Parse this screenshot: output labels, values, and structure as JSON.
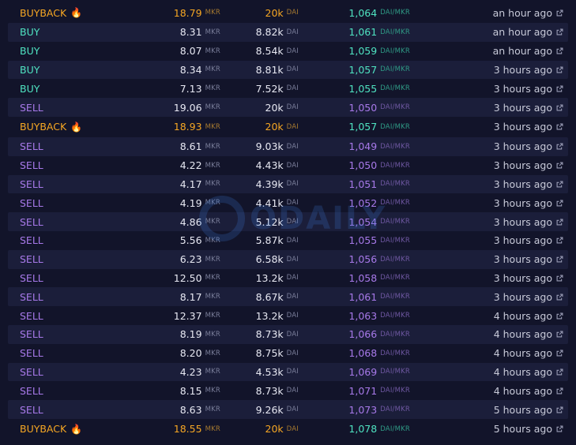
{
  "colors": {
    "background": "#12142a",
    "row_alt": "#1b1e3a",
    "buyback": "#f5a623",
    "buy": "#4fe3c1",
    "sell": "#a779e9"
  },
  "watermark": {
    "text": "ODAILY"
  },
  "trades": [
    {
      "type": "BUYBACK",
      "fire": "🔥",
      "amount": "18.79",
      "amount_unit": "MKR",
      "dai": "20k",
      "dai_unit": "DAI",
      "price": "1,064",
      "price_unit": "DAI/MKR",
      "price_color": "teal",
      "time": "an hour ago"
    },
    {
      "type": "BUY",
      "amount": "8.31",
      "amount_unit": "MKR",
      "dai": "8.82k",
      "dai_unit": "DAI",
      "price": "1,061",
      "price_unit": "DAI/MKR",
      "price_color": "teal",
      "time": "an hour ago"
    },
    {
      "type": "BUY",
      "amount": "8.07",
      "amount_unit": "MKR",
      "dai": "8.54k",
      "dai_unit": "DAI",
      "price": "1,059",
      "price_unit": "DAI/MKR",
      "price_color": "teal",
      "time": "an hour ago"
    },
    {
      "type": "BUY",
      "amount": "8.34",
      "amount_unit": "MKR",
      "dai": "8.81k",
      "dai_unit": "DAI",
      "price": "1,057",
      "price_unit": "DAI/MKR",
      "price_color": "teal",
      "time": "3 hours ago"
    },
    {
      "type": "BUY",
      "amount": "7.13",
      "amount_unit": "MKR",
      "dai": "7.52k",
      "dai_unit": "DAI",
      "price": "1,055",
      "price_unit": "DAI/MKR",
      "price_color": "teal",
      "time": "3 hours ago"
    },
    {
      "type": "SELL",
      "amount": "19.06",
      "amount_unit": "MKR",
      "dai": "20k",
      "dai_unit": "DAI",
      "price": "1,050",
      "price_unit": "DAI/MKR",
      "price_color": "purple",
      "time": "3 hours ago"
    },
    {
      "type": "BUYBACK",
      "fire": "🔥",
      "amount": "18.93",
      "amount_unit": "MKR",
      "dai": "20k",
      "dai_unit": "DAI",
      "price": "1,057",
      "price_unit": "DAI/MKR",
      "price_color": "teal",
      "time": "3 hours ago"
    },
    {
      "type": "SELL",
      "amount": "8.61",
      "amount_unit": "MKR",
      "dai": "9.03k",
      "dai_unit": "DAI",
      "price": "1,049",
      "price_unit": "DAI/MKR",
      "price_color": "purple",
      "time": "3 hours ago"
    },
    {
      "type": "SELL",
      "amount": "4.22",
      "amount_unit": "MKR",
      "dai": "4.43k",
      "dai_unit": "DAI",
      "price": "1,050",
      "price_unit": "DAI/MKR",
      "price_color": "purple",
      "time": "3 hours ago"
    },
    {
      "type": "SELL",
      "amount": "4.17",
      "amount_unit": "MKR",
      "dai": "4.39k",
      "dai_unit": "DAI",
      "price": "1,051",
      "price_unit": "DAI/MKR",
      "price_color": "purple",
      "time": "3 hours ago"
    },
    {
      "type": "SELL",
      "amount": "4.19",
      "amount_unit": "MKR",
      "dai": "4.41k",
      "dai_unit": "DAI",
      "price": "1,052",
      "price_unit": "DAI/MKR",
      "price_color": "purple",
      "time": "3 hours ago"
    },
    {
      "type": "SELL",
      "amount": "4.86",
      "amount_unit": "MKR",
      "dai": "5.12k",
      "dai_unit": "DAI",
      "price": "1,054",
      "price_unit": "DAI/MKR",
      "price_color": "purple",
      "time": "3 hours ago"
    },
    {
      "type": "SELL",
      "amount": "5.56",
      "amount_unit": "MKR",
      "dai": "5.87k",
      "dai_unit": "DAI",
      "price": "1,055",
      "price_unit": "DAI/MKR",
      "price_color": "purple",
      "time": "3 hours ago"
    },
    {
      "type": "SELL",
      "amount": "6.23",
      "amount_unit": "MKR",
      "dai": "6.58k",
      "dai_unit": "DAI",
      "price": "1,056",
      "price_unit": "DAI/MKR",
      "price_color": "purple",
      "time": "3 hours ago"
    },
    {
      "type": "SELL",
      "amount": "12.50",
      "amount_unit": "MKR",
      "dai": "13.2k",
      "dai_unit": "DAI",
      "price": "1,058",
      "price_unit": "DAI/MKR",
      "price_color": "purple",
      "time": "3 hours ago"
    },
    {
      "type": "SELL",
      "amount": "8.17",
      "amount_unit": "MKR",
      "dai": "8.67k",
      "dai_unit": "DAI",
      "price": "1,061",
      "price_unit": "DAI/MKR",
      "price_color": "purple",
      "time": "3 hours ago"
    },
    {
      "type": "SELL",
      "amount": "12.37",
      "amount_unit": "MKR",
      "dai": "13.2k",
      "dai_unit": "DAI",
      "price": "1,063",
      "price_unit": "DAI/MKR",
      "price_color": "purple",
      "time": "4 hours ago"
    },
    {
      "type": "SELL",
      "amount": "8.19",
      "amount_unit": "MKR",
      "dai": "8.73k",
      "dai_unit": "DAI",
      "price": "1,066",
      "price_unit": "DAI/MKR",
      "price_color": "purple",
      "time": "4 hours ago"
    },
    {
      "type": "SELL",
      "amount": "8.20",
      "amount_unit": "MKR",
      "dai": "8.75k",
      "dai_unit": "DAI",
      "price": "1,068",
      "price_unit": "DAI/MKR",
      "price_color": "purple",
      "time": "4 hours ago"
    },
    {
      "type": "SELL",
      "amount": "4.23",
      "amount_unit": "MKR",
      "dai": "4.53k",
      "dai_unit": "DAI",
      "price": "1,069",
      "price_unit": "DAI/MKR",
      "price_color": "purple",
      "time": "4 hours ago"
    },
    {
      "type": "SELL",
      "amount": "8.15",
      "amount_unit": "MKR",
      "dai": "8.73k",
      "dai_unit": "DAI",
      "price": "1,071",
      "price_unit": "DAI/MKR",
      "price_color": "purple",
      "time": "4 hours ago"
    },
    {
      "type": "SELL",
      "amount": "8.63",
      "amount_unit": "MKR",
      "dai": "9.26k",
      "dai_unit": "DAI",
      "price": "1,073",
      "price_unit": "DAI/MKR",
      "price_color": "purple",
      "time": "5 hours ago"
    },
    {
      "type": "BUYBACK",
      "fire": "🔥",
      "amount": "18.55",
      "amount_unit": "MKR",
      "dai": "20k",
      "dai_unit": "DAI",
      "price": "1,078",
      "price_unit": "DAI/MKR",
      "price_color": "teal",
      "time": "5 hours ago"
    }
  ],
  "icons": {
    "time_link": "external-link-icon",
    "buyback_marker": "fire-icon"
  }
}
